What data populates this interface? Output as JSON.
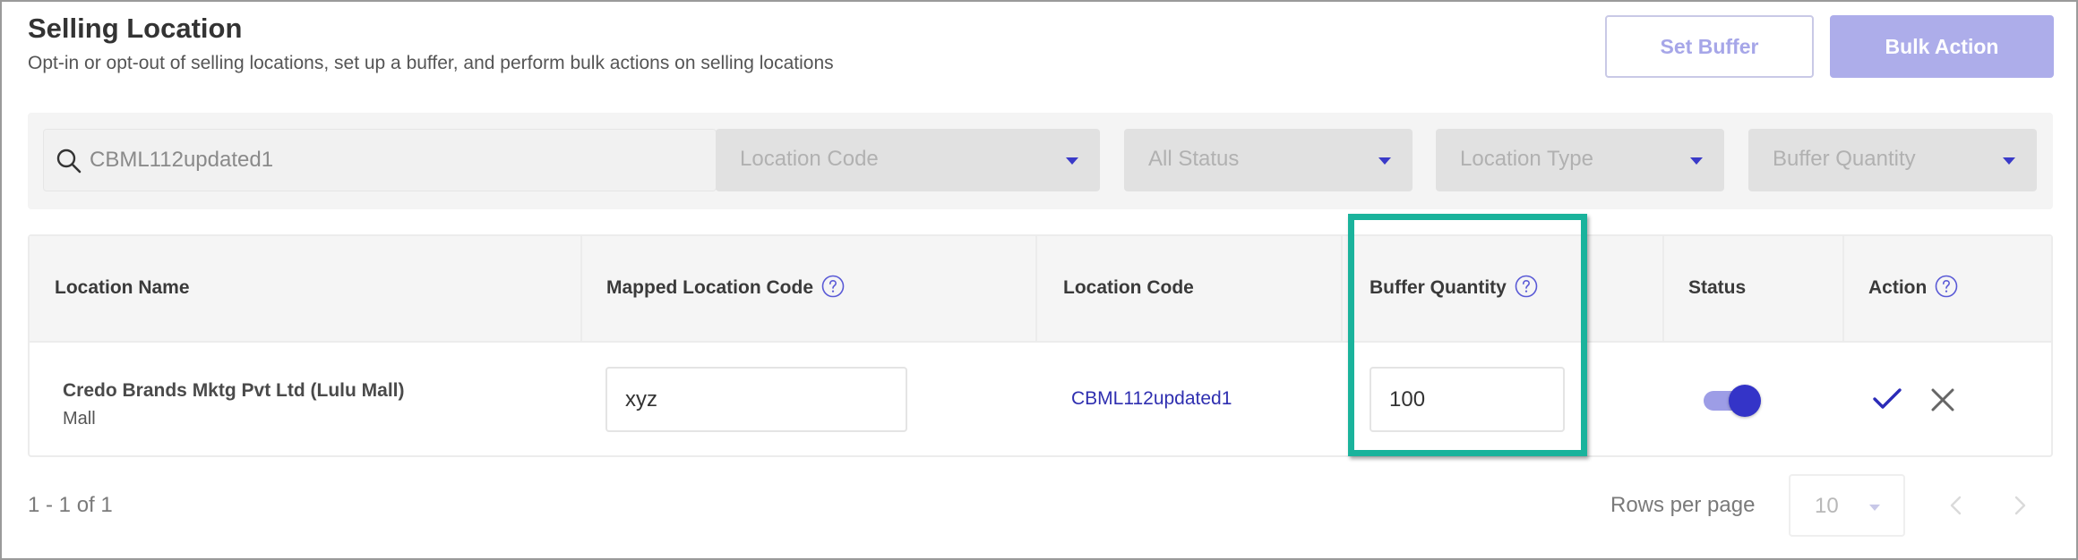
{
  "header": {
    "title": "Selling Location",
    "subtitle": "Opt-in or opt-out of selling locations, set up a buffer, and perform bulk actions on selling locations",
    "set_buffer_label": "Set Buffer",
    "bulk_action_label": "Bulk Action"
  },
  "filters": {
    "search_value": "CBML112updated1",
    "location_code_placeholder": "Location Code",
    "status_placeholder": "All Status",
    "location_type_placeholder": "Location Type",
    "buffer_quantity_placeholder": "Buffer Quantity"
  },
  "table": {
    "columns": [
      "Location Name",
      "Mapped Location Code",
      "Location Code",
      "Buffer Quantity",
      "Status",
      "Action"
    ],
    "rows": [
      {
        "location_name": "Credo Brands Mktg Pvt Ltd (Lulu Mall)",
        "location_type": "Mall",
        "mapped_location_code": "xyz",
        "location_code": "CBML112updated1",
        "buffer_quantity": "100",
        "status_enabled": true
      }
    ]
  },
  "pagination": {
    "range": "1 - 1 of 1",
    "rows_per_page_label": "Rows per page",
    "rows_per_page_value": "10"
  },
  "colors": {
    "accent": "#3434c8",
    "highlight": "#1ab39c",
    "link": "#2f2fb0"
  },
  "icons": [
    "search-icon",
    "chevron-down-icon",
    "help-circle-icon",
    "check-icon",
    "close-icon",
    "chevron-left-icon",
    "chevron-right-icon"
  ]
}
